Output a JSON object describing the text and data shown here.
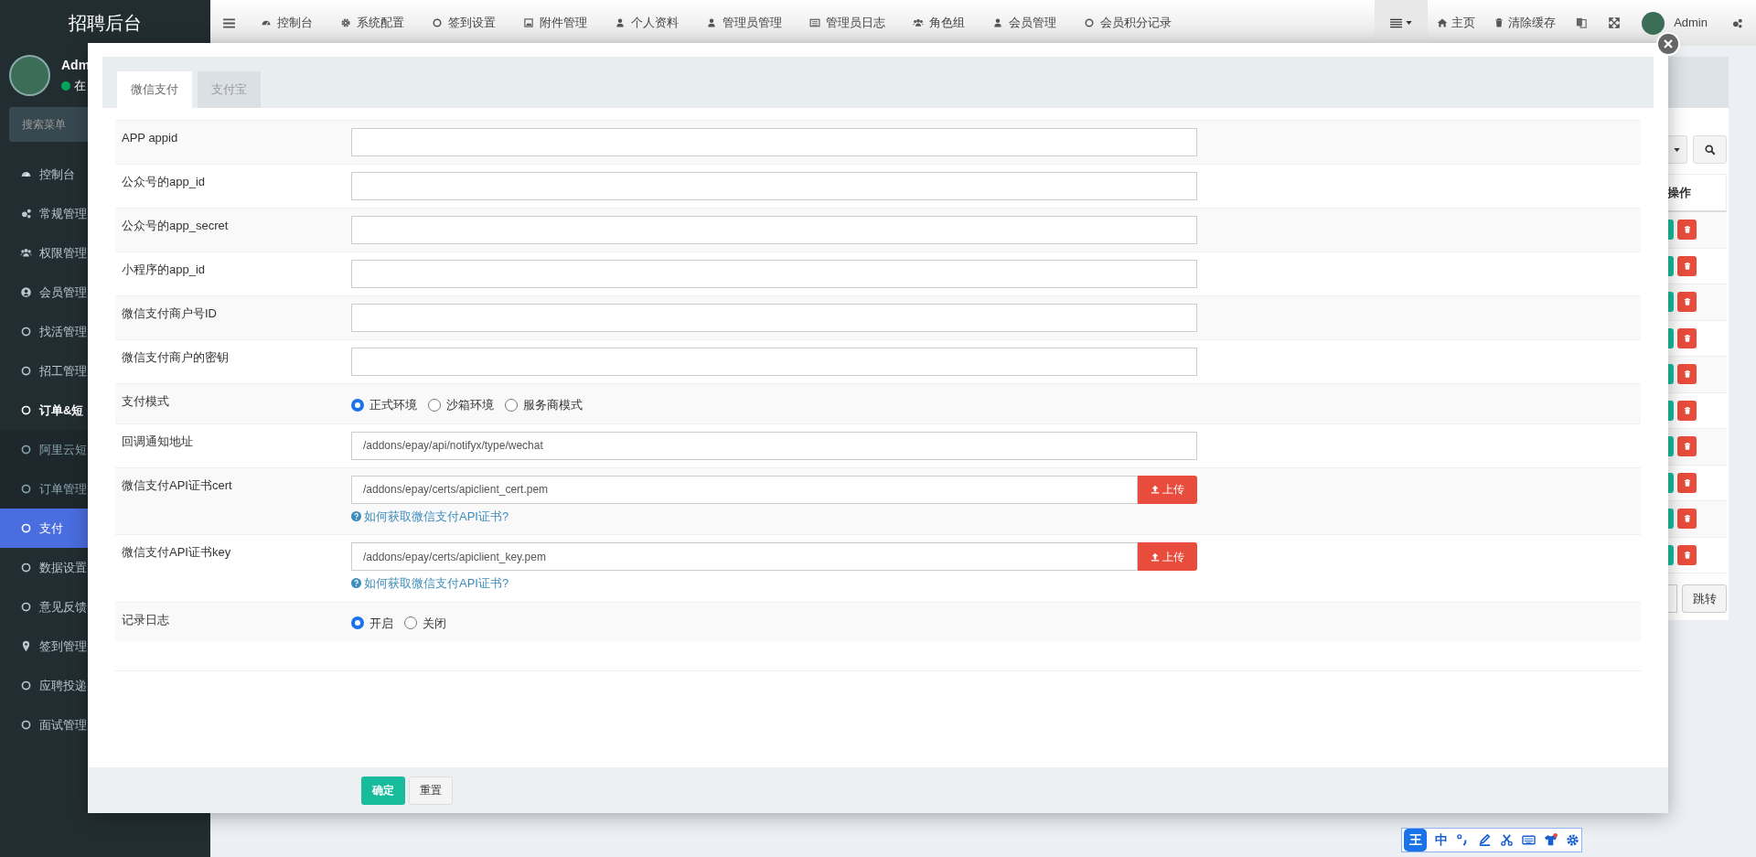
{
  "header": {
    "logo": "招聘后台",
    "nav": [
      {
        "label": "控制台"
      },
      {
        "label": "系统配置"
      },
      {
        "label": "签到设置"
      },
      {
        "label": "附件管理"
      },
      {
        "label": "个人资料"
      },
      {
        "label": "管理员管理"
      },
      {
        "label": "管理员日志"
      },
      {
        "label": "角色组"
      },
      {
        "label": "会员管理"
      },
      {
        "label": "会员积分记录"
      }
    ],
    "right": [
      {
        "label": "主页"
      },
      {
        "label": "清除缓存"
      }
    ],
    "user": "Admin"
  },
  "sidebar": {
    "user_name": "Adm",
    "status": "在",
    "search": {
      "placeholder": "搜索菜单"
    },
    "items": [
      {
        "label": "控制台",
        "selected": false
      },
      {
        "label": "常规管理",
        "selected": false
      },
      {
        "label": "权限管理",
        "selected": false
      },
      {
        "label": "会员管理",
        "selected": false
      },
      {
        "label": "找活管理",
        "selected": false
      },
      {
        "label": "招工管理",
        "selected": false
      },
      {
        "label": "订单&短",
        "selected": false,
        "expanded": true,
        "children": [
          {
            "label": "阿里云短",
            "selected": false
          },
          {
            "label": "订单管理",
            "selected": false
          }
        ]
      },
      {
        "label": "支付",
        "selected": true
      },
      {
        "label": "数据设置",
        "selected": false
      },
      {
        "label": "意见反馈",
        "selected": false
      },
      {
        "label": "签到管理",
        "selected": false
      },
      {
        "label": "应聘投递",
        "selected": false
      },
      {
        "label": "面试管理",
        "selected": false
      }
    ]
  },
  "background_table": {
    "column": "操作",
    "jump_button": "跳转"
  },
  "dialog": {
    "tabs": [
      {
        "label": "微信支付",
        "selected": true
      },
      {
        "label": "支付宝",
        "selected": false
      }
    ],
    "fields": [
      {
        "kind": "text",
        "label": "APP appid"
      },
      {
        "kind": "text",
        "label": "公众号的app_id"
      },
      {
        "kind": "text",
        "label": "公众号的app_secret"
      },
      {
        "kind": "text",
        "label": "小程序的app_id"
      },
      {
        "kind": "text",
        "label": "微信支付商户号ID"
      },
      {
        "kind": "text",
        "label": "微信支付商户的密钥"
      },
      {
        "kind": "radio",
        "label": "支付模式",
        "options": [
          {
            "label": "正式环境",
            "selected": true
          },
          {
            "label": "沙箱环境",
            "selected": false
          },
          {
            "label": "服务商模式",
            "selected": false
          }
        ]
      },
      {
        "kind": "text",
        "label": "回调通知地址",
        "value": "/addons/epay/api/notifyx/type/wechat"
      },
      {
        "kind": "file",
        "label": "微信支付API证书cert",
        "value": "/addons/epay/certs/apiclient_cert.pem",
        "button": "上传",
        "help": "如何获取微信支付API证书?"
      },
      {
        "kind": "file",
        "label": "微信支付API证书key",
        "value": "/addons/epay/certs/apiclient_key.pem",
        "button": "上传",
        "help": "如何获取微信支付API证书?"
      },
      {
        "kind": "radio",
        "label": "记录日志",
        "options": [
          {
            "label": "开启",
            "selected": true
          },
          {
            "label": "关闭",
            "selected": false
          }
        ]
      }
    ],
    "buttons": [
      {
        "kind": "primary",
        "label": "确定"
      },
      {
        "kind": "default",
        "label": "重置"
      }
    ]
  },
  "ime_toolbar": {
    "logo": "王",
    "mode": "中"
  }
}
